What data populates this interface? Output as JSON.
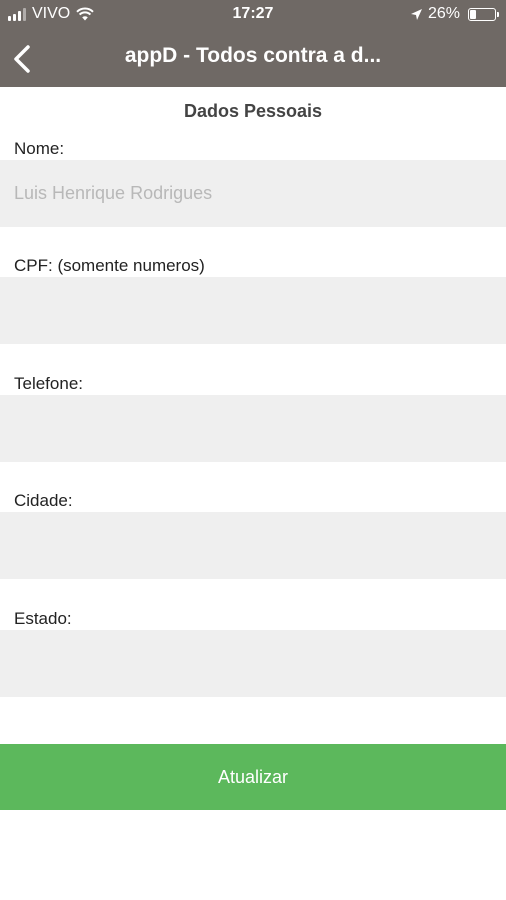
{
  "status_bar": {
    "carrier": "VIVO",
    "time": "17:27",
    "battery_percent": "26%",
    "battery_level": 0.26,
    "signal_bars_active": 3
  },
  "nav": {
    "title": "appD - Todos contra a d...",
    "back_icon": "chevron-left-icon"
  },
  "section_title": "Dados Pessoais",
  "fields": {
    "nome": {
      "label": "Nome:",
      "value": "",
      "placeholder": "Luis Henrique Rodrigues"
    },
    "cpf": {
      "label": "CPF: (somente numeros)",
      "value": "",
      "placeholder": ""
    },
    "telefone": {
      "label": "Telefone:",
      "value": "",
      "placeholder": ""
    },
    "cidade": {
      "label": "Cidade:",
      "value": "",
      "placeholder": ""
    },
    "estado": {
      "label": "Estado:",
      "value": "",
      "placeholder": ""
    }
  },
  "update_button": "Atualizar",
  "colors": {
    "header": "#6f6965",
    "button": "#5cb85c",
    "input_bg": "#efefef"
  }
}
